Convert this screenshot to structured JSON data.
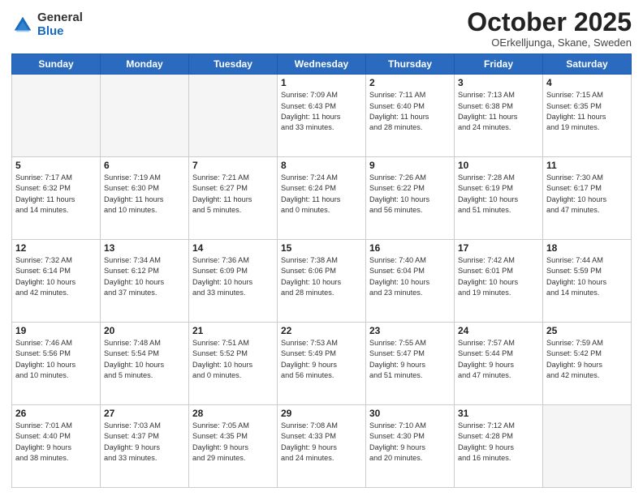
{
  "header": {
    "logo_general": "General",
    "logo_blue": "Blue",
    "month": "October 2025",
    "location": "OErkelljunga, Skane, Sweden"
  },
  "days_of_week": [
    "Sunday",
    "Monday",
    "Tuesday",
    "Wednesday",
    "Thursday",
    "Friday",
    "Saturday"
  ],
  "weeks": [
    [
      {
        "day": "",
        "info": ""
      },
      {
        "day": "",
        "info": ""
      },
      {
        "day": "",
        "info": ""
      },
      {
        "day": "1",
        "info": "Sunrise: 7:09 AM\nSunset: 6:43 PM\nDaylight: 11 hours\nand 33 minutes."
      },
      {
        "day": "2",
        "info": "Sunrise: 7:11 AM\nSunset: 6:40 PM\nDaylight: 11 hours\nand 28 minutes."
      },
      {
        "day": "3",
        "info": "Sunrise: 7:13 AM\nSunset: 6:38 PM\nDaylight: 11 hours\nand 24 minutes."
      },
      {
        "day": "4",
        "info": "Sunrise: 7:15 AM\nSunset: 6:35 PM\nDaylight: 11 hours\nand 19 minutes."
      }
    ],
    [
      {
        "day": "5",
        "info": "Sunrise: 7:17 AM\nSunset: 6:32 PM\nDaylight: 11 hours\nand 14 minutes."
      },
      {
        "day": "6",
        "info": "Sunrise: 7:19 AM\nSunset: 6:30 PM\nDaylight: 11 hours\nand 10 minutes."
      },
      {
        "day": "7",
        "info": "Sunrise: 7:21 AM\nSunset: 6:27 PM\nDaylight: 11 hours\nand 5 minutes."
      },
      {
        "day": "8",
        "info": "Sunrise: 7:24 AM\nSunset: 6:24 PM\nDaylight: 11 hours\nand 0 minutes."
      },
      {
        "day": "9",
        "info": "Sunrise: 7:26 AM\nSunset: 6:22 PM\nDaylight: 10 hours\nand 56 minutes."
      },
      {
        "day": "10",
        "info": "Sunrise: 7:28 AM\nSunset: 6:19 PM\nDaylight: 10 hours\nand 51 minutes."
      },
      {
        "day": "11",
        "info": "Sunrise: 7:30 AM\nSunset: 6:17 PM\nDaylight: 10 hours\nand 47 minutes."
      }
    ],
    [
      {
        "day": "12",
        "info": "Sunrise: 7:32 AM\nSunset: 6:14 PM\nDaylight: 10 hours\nand 42 minutes."
      },
      {
        "day": "13",
        "info": "Sunrise: 7:34 AM\nSunset: 6:12 PM\nDaylight: 10 hours\nand 37 minutes."
      },
      {
        "day": "14",
        "info": "Sunrise: 7:36 AM\nSunset: 6:09 PM\nDaylight: 10 hours\nand 33 minutes."
      },
      {
        "day": "15",
        "info": "Sunrise: 7:38 AM\nSunset: 6:06 PM\nDaylight: 10 hours\nand 28 minutes."
      },
      {
        "day": "16",
        "info": "Sunrise: 7:40 AM\nSunset: 6:04 PM\nDaylight: 10 hours\nand 23 minutes."
      },
      {
        "day": "17",
        "info": "Sunrise: 7:42 AM\nSunset: 6:01 PM\nDaylight: 10 hours\nand 19 minutes."
      },
      {
        "day": "18",
        "info": "Sunrise: 7:44 AM\nSunset: 5:59 PM\nDaylight: 10 hours\nand 14 minutes."
      }
    ],
    [
      {
        "day": "19",
        "info": "Sunrise: 7:46 AM\nSunset: 5:56 PM\nDaylight: 10 hours\nand 10 minutes."
      },
      {
        "day": "20",
        "info": "Sunrise: 7:48 AM\nSunset: 5:54 PM\nDaylight: 10 hours\nand 5 minutes."
      },
      {
        "day": "21",
        "info": "Sunrise: 7:51 AM\nSunset: 5:52 PM\nDaylight: 10 hours\nand 0 minutes."
      },
      {
        "day": "22",
        "info": "Sunrise: 7:53 AM\nSunset: 5:49 PM\nDaylight: 9 hours\nand 56 minutes."
      },
      {
        "day": "23",
        "info": "Sunrise: 7:55 AM\nSunset: 5:47 PM\nDaylight: 9 hours\nand 51 minutes."
      },
      {
        "day": "24",
        "info": "Sunrise: 7:57 AM\nSunset: 5:44 PM\nDaylight: 9 hours\nand 47 minutes."
      },
      {
        "day": "25",
        "info": "Sunrise: 7:59 AM\nSunset: 5:42 PM\nDaylight: 9 hours\nand 42 minutes."
      }
    ],
    [
      {
        "day": "26",
        "info": "Sunrise: 7:01 AM\nSunset: 4:40 PM\nDaylight: 9 hours\nand 38 minutes."
      },
      {
        "day": "27",
        "info": "Sunrise: 7:03 AM\nSunset: 4:37 PM\nDaylight: 9 hours\nand 33 minutes."
      },
      {
        "day": "28",
        "info": "Sunrise: 7:05 AM\nSunset: 4:35 PM\nDaylight: 9 hours\nand 29 minutes."
      },
      {
        "day": "29",
        "info": "Sunrise: 7:08 AM\nSunset: 4:33 PM\nDaylight: 9 hours\nand 24 minutes."
      },
      {
        "day": "30",
        "info": "Sunrise: 7:10 AM\nSunset: 4:30 PM\nDaylight: 9 hours\nand 20 minutes."
      },
      {
        "day": "31",
        "info": "Sunrise: 7:12 AM\nSunset: 4:28 PM\nDaylight: 9 hours\nand 16 minutes."
      },
      {
        "day": "",
        "info": ""
      }
    ]
  ]
}
